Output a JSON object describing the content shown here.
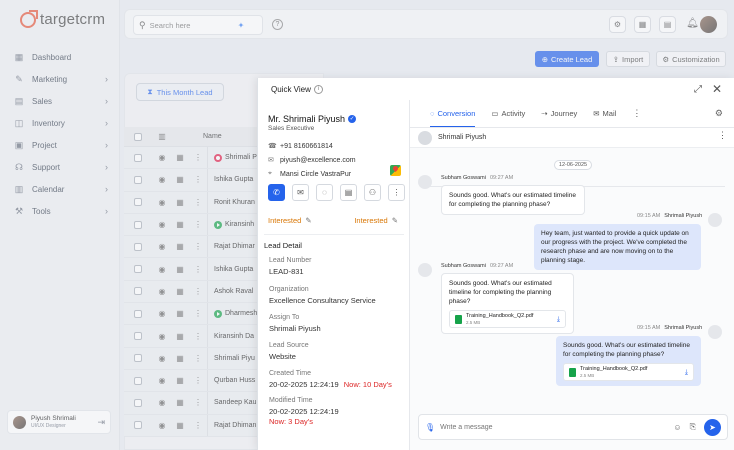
{
  "brand": {
    "name": "targetcrm",
    "accent": "#e6583d",
    "primary": "#2563eb"
  },
  "sidebar": {
    "items": [
      {
        "label": "Dashboard",
        "icon": "dashboard-icon",
        "chevron": false
      },
      {
        "label": "Marketing",
        "icon": "megaphone-icon",
        "chevron": true
      },
      {
        "label": "Sales",
        "icon": "sales-icon",
        "chevron": true
      },
      {
        "label": "Inventory",
        "icon": "inventory-icon",
        "chevron": true
      },
      {
        "label": "Project",
        "icon": "project-icon",
        "chevron": true
      },
      {
        "label": "Support",
        "icon": "support-icon",
        "chevron": true
      },
      {
        "label": "Calendar",
        "icon": "calendar-icon",
        "chevron": true
      },
      {
        "label": "Tools",
        "icon": "tools-icon",
        "chevron": true
      }
    ],
    "user": {
      "name": "Piyush Shrimali",
      "role": "UI/UX Designer"
    }
  },
  "topbar": {
    "search_placeholder": "Search here"
  },
  "actions": {
    "create": "Create Lead",
    "import": "Import",
    "customization": "Customization"
  },
  "leads_panel": {
    "filter": "This Month Lead",
    "column_name": "Name",
    "rows": [
      {
        "name": "Shrimali P",
        "status": "red"
      },
      {
        "name": "Ishika Gupta",
        "status": ""
      },
      {
        "name": "Ronit Khuran",
        "status": ""
      },
      {
        "name": "Kiransinh",
        "status": "green"
      },
      {
        "name": "Rajat Dhimar",
        "status": ""
      },
      {
        "name": "Ishika Gupta",
        "status": ""
      },
      {
        "name": "Ashok Raval",
        "status": ""
      },
      {
        "name": "Dharmesh",
        "status": "green"
      },
      {
        "name": "Kiransinh Da",
        "status": ""
      },
      {
        "name": "Shrimali Piyu",
        "status": ""
      },
      {
        "name": "Qurban Huss",
        "status": ""
      },
      {
        "name": "Sandeep Kau",
        "status": ""
      },
      {
        "name": "Rajat Dhiman",
        "status": ""
      }
    ]
  },
  "quick_view": {
    "title": "Quick View",
    "lead": {
      "name": "Mr. Shrimali Piyush",
      "role": "Sales Executive",
      "phone": "+91 8160661814",
      "email": "piyush@excellence.com",
      "address": "Mansi Circle VastraPur",
      "status_left": "Interested",
      "status_right": "Interested"
    },
    "detail_title": "Lead Detail",
    "fields": {
      "lead_number_label": "Lead Number",
      "lead_number": "LEAD-831",
      "organization_label": "Organization",
      "organization": "Excellence Consultancy Service",
      "assign_label": "Assign To",
      "assign": "Shrimali Piyush",
      "source_label": "Lead Source",
      "source": "Website",
      "created_label": "Created Time",
      "created": "20-02-2025 12:24:19",
      "created_ago": "Now: 10 Day's",
      "modified_label": "Modified Time",
      "modified": "20-02-2025 12:24:19",
      "modified_ago": "Now: 3 Day's"
    },
    "tabs": [
      {
        "label": "Conversion",
        "icon": "chat-icon",
        "active": true
      },
      {
        "label": "Activity",
        "icon": "activity-icon",
        "active": false
      },
      {
        "label": "Journey",
        "icon": "journey-icon",
        "active": false
      },
      {
        "label": "Mail",
        "icon": "mail-icon",
        "active": false
      }
    ],
    "chat": {
      "contact": "Shrimali Piyush",
      "date": "12-06-2025",
      "messages": [
        {
          "sender": "Subham Goswami",
          "time": "09:27 AM",
          "text": "Sounds good. What's our estimated timeline for completing the planning phase?",
          "side": "in"
        },
        {
          "sender": "Shrimali Piyush",
          "time": "09:15 AM",
          "text": "Hey team, just wanted to provide a quick update on our progress with the project. We've completed the research phase and are now moving on to the planning stage.",
          "side": "out"
        },
        {
          "sender": "Subham Goswami",
          "time": "09:27 AM",
          "text": "Sounds good. What's our estimated timeline for completing the planning phase?",
          "side": "in",
          "file": {
            "name": "Training_Handbook_Q2.pdf",
            "size": "2.5 MB"
          }
        },
        {
          "sender": "Shrimali Piyush",
          "time": "09:15 AM",
          "text": "Sounds good. What's our estimated timeline for completing the planning phase?",
          "side": "out",
          "file": {
            "name": "Training_Handbook_Q2.pdf",
            "size": "2.5 MB"
          }
        }
      ],
      "composer_placeholder": "Write a message"
    }
  }
}
